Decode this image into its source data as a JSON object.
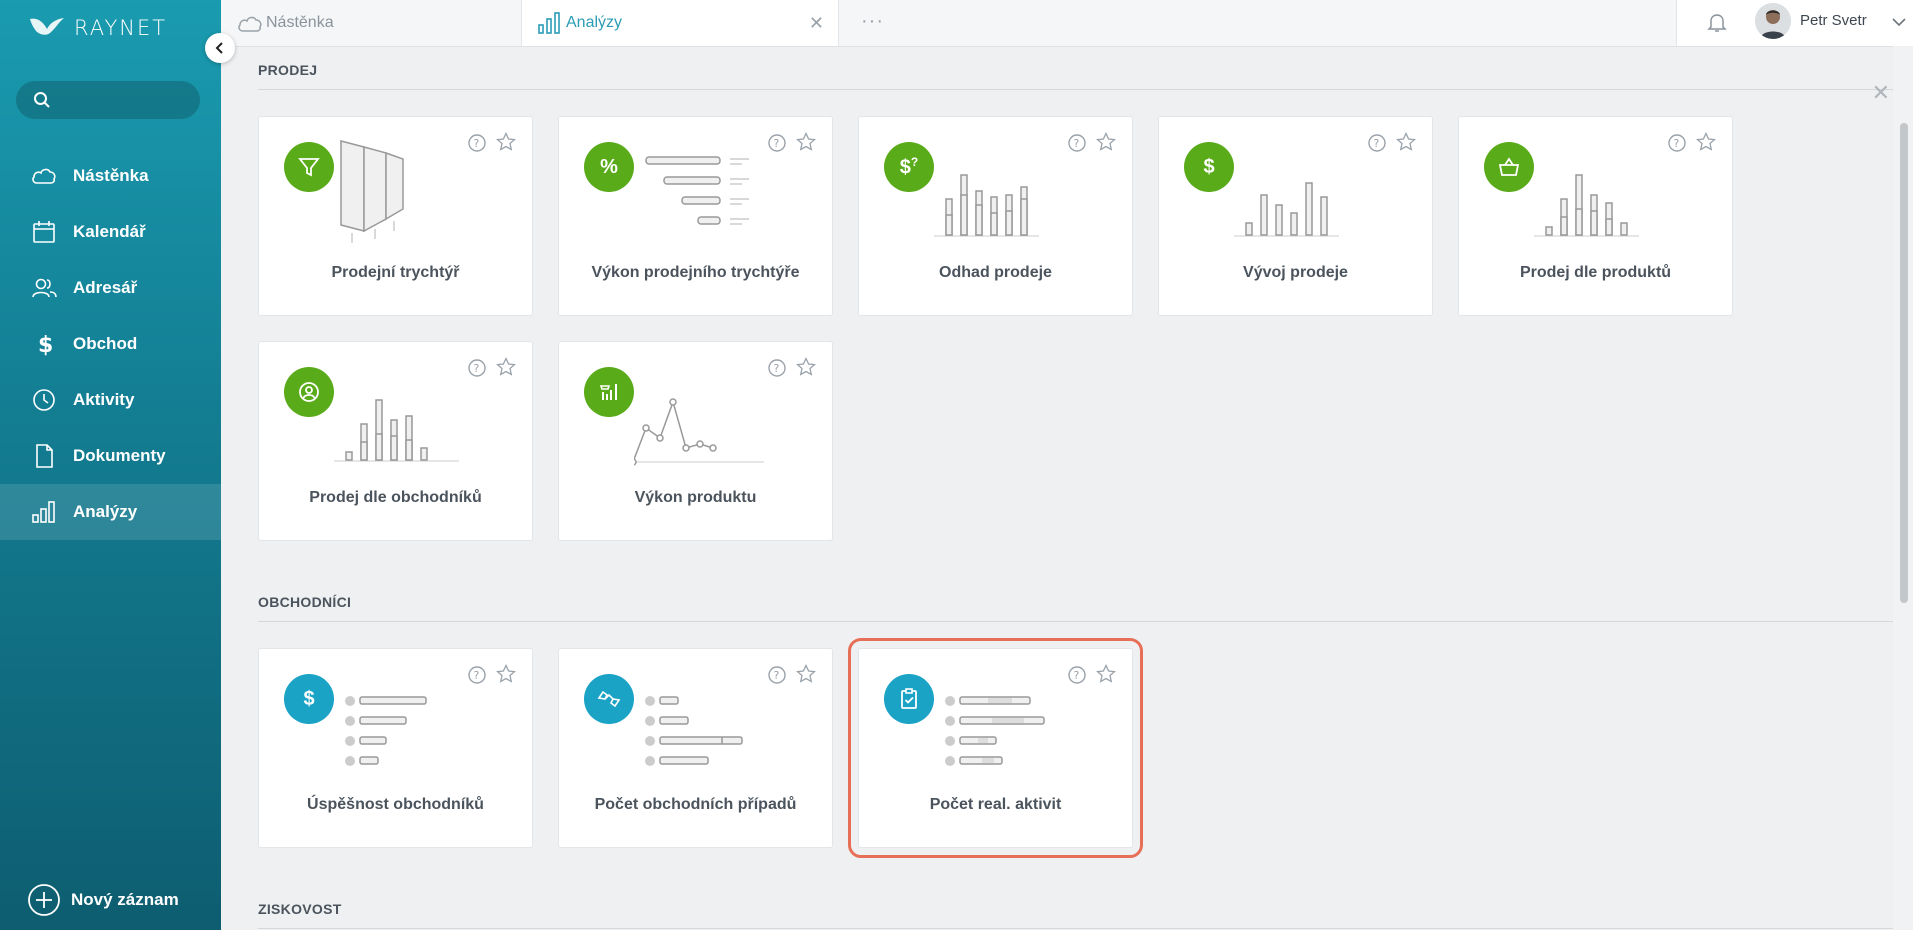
{
  "app": {
    "logo_text": "RAYNET"
  },
  "search": {
    "placeholder": ""
  },
  "sidebar": {
    "items": [
      {
        "label": "Nástěnka",
        "icon": "cloud-icon"
      },
      {
        "label": "Kalendář",
        "icon": "calendar-icon"
      },
      {
        "label": "Adresář",
        "icon": "contacts-icon"
      },
      {
        "label": "Obchod",
        "icon": "dollar-icon"
      },
      {
        "label": "Aktivity",
        "icon": "clock-icon"
      },
      {
        "label": "Dokumenty",
        "icon": "document-icon"
      },
      {
        "label": "Analýzy",
        "icon": "bar-chart-icon",
        "active": true
      }
    ],
    "new_record": "Nový záznam"
  },
  "tabs": [
    {
      "label": "Nástěnka",
      "icon": "cloud-icon"
    },
    {
      "label": "Analýzy",
      "icon": "bar-chart-icon",
      "active": true
    }
  ],
  "user": {
    "name": "Petr Svetr"
  },
  "sections": [
    {
      "title": "PRODEJ",
      "cards": [
        {
          "label": "Prodejní trychtýř",
          "icon": "filter-icon"
        },
        {
          "label": "Výkon prodejního trychtýře",
          "icon": "percent-icon"
        },
        {
          "label": "Odhad prodeje",
          "icon": "dollar-question-icon"
        },
        {
          "label": "Vývoj prodeje",
          "icon": "dollar-icon"
        },
        {
          "label": "Prodej dle produktů",
          "icon": "basket-icon"
        },
        {
          "label": "Prodej dle obchodníků",
          "icon": "user-circle-icon"
        },
        {
          "label": "Výkon produktu",
          "icon": "product-chart-icon"
        }
      ]
    },
    {
      "title": "OBCHODNÍCI",
      "cards": [
        {
          "label": "Úspěšnost obchodníků",
          "icon": "dollar-icon"
        },
        {
          "label": "Počet obchodních případů",
          "icon": "handshake-icon"
        },
        {
          "label": "Počet real. aktivit",
          "icon": "clipboard-check-icon",
          "highlighted": true
        }
      ]
    },
    {
      "title": "ZISKOVOST"
    }
  ],
  "colors": {
    "sidebar_top": "#1a9bb0",
    "sidebar_bottom": "#0e5d70",
    "green": "#5aab1a",
    "blue": "#1ba3c6",
    "highlight": "#e86f57",
    "accent": "#2a9cb5"
  }
}
